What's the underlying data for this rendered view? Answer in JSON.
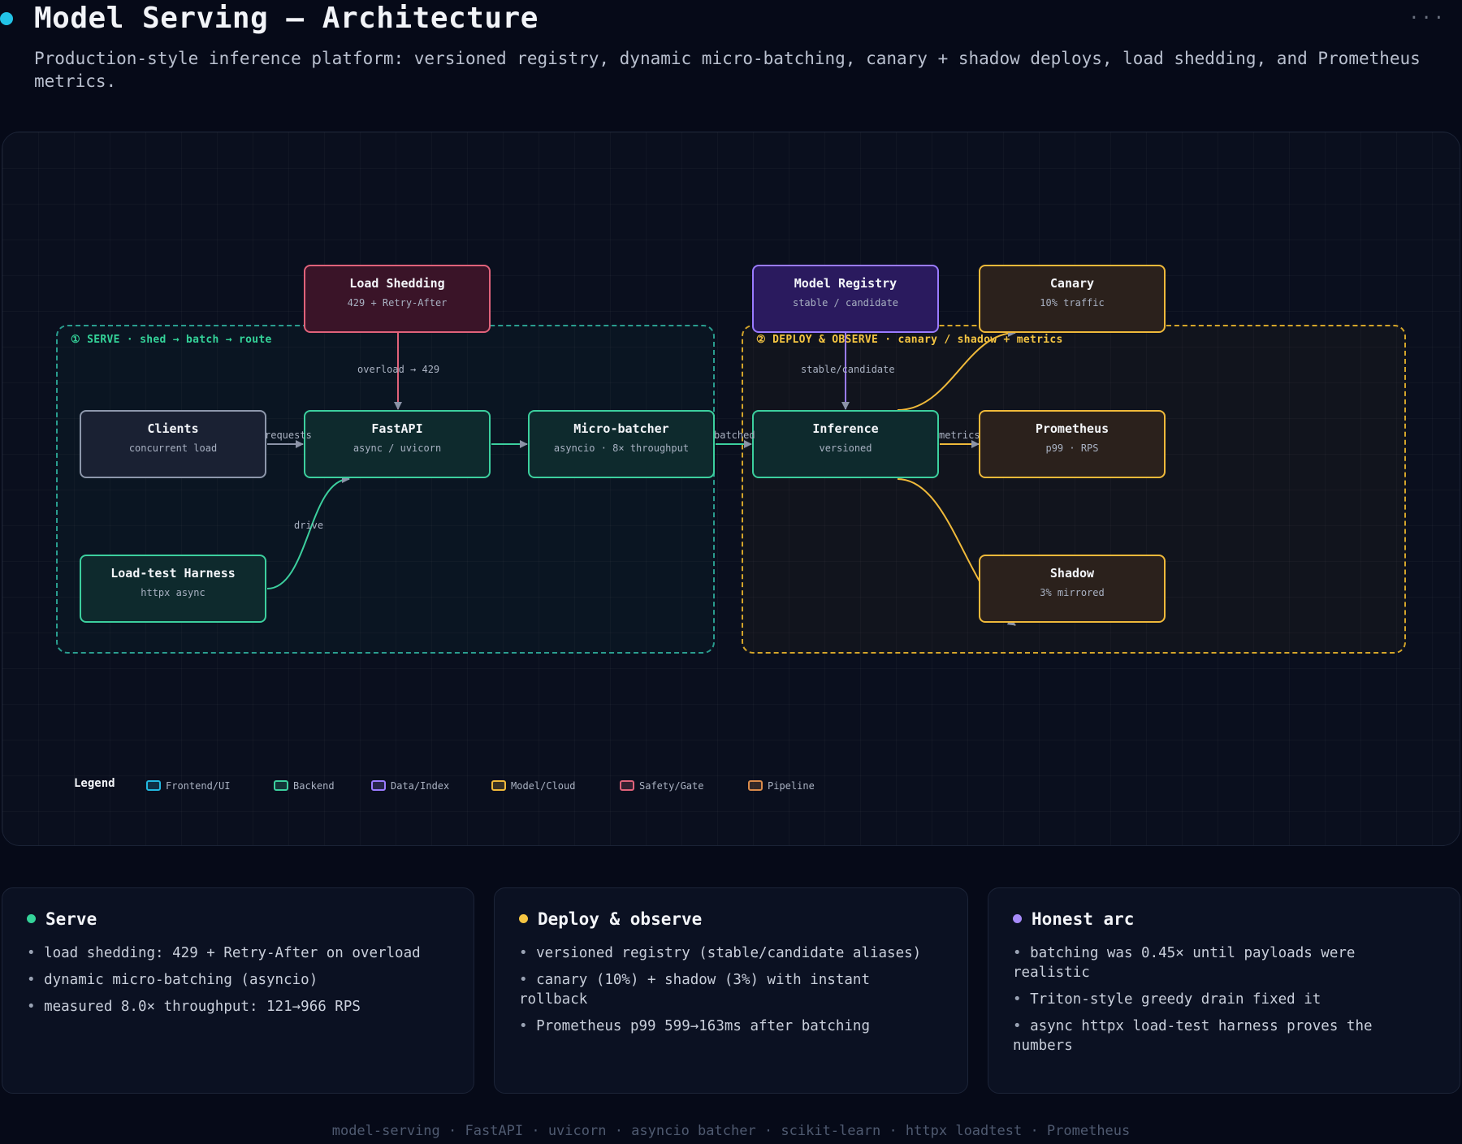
{
  "header": {
    "title": "Model Serving — Architecture",
    "subtitle": "Production-style inference platform: versioned registry, dynamic micro-batching, canary + shadow deploys, load shedding, and Prometheus metrics.",
    "more_icon": "more-icon",
    "dot_color": "#22c3e6"
  },
  "diagram": {
    "groups": {
      "serve": "① SERVE · shed → batch → route",
      "deploy": "② DEPLOY & OBSERVE · canary / shadow + metrics"
    },
    "nodes": {
      "load_shedding": {
        "title": "Load Shedding",
        "sub": "429 + Retry-After"
      },
      "model_registry": {
        "title": "Model Registry",
        "sub": "stable / candidate"
      },
      "canary": {
        "title": "Canary",
        "sub": "10% traffic"
      },
      "clients": {
        "title": "Clients",
        "sub": "concurrent load"
      },
      "fastapi": {
        "title": "FastAPI",
        "sub": "async / uvicorn"
      },
      "micro_batcher": {
        "title": "Micro-batcher",
        "sub": "asyncio · 8× throughput"
      },
      "inference": {
        "title": "Inference",
        "sub": "versioned"
      },
      "prometheus": {
        "title": "Prometheus",
        "sub": "p99 · RPS"
      },
      "load_test": {
        "title": "Load-test Harness",
        "sub": "httpx async"
      },
      "shadow": {
        "title": "Shadow",
        "sub": "3% mirrored"
      }
    },
    "edge_labels": {
      "overload": "overload → 429",
      "stable_candidate": "stable/candidate",
      "requests": "requests",
      "batched": "batched",
      "metrics": "metrics",
      "drive": "drive"
    }
  },
  "legend": {
    "title": "Legend",
    "items": [
      {
        "label": "Frontend/UI",
        "color": "#22b8e0"
      },
      {
        "label": "Backend",
        "color": "#3ccf9e"
      },
      {
        "label": "Data/Index",
        "color": "#9a7bff"
      },
      {
        "label": "Model/Cloud",
        "color": "#efb93a"
      },
      {
        "label": "Safety/Gate",
        "color": "#e0627a"
      },
      {
        "label": "Pipeline",
        "color": "#d98a4a"
      }
    ]
  },
  "cards": {
    "serve": {
      "title": "Serve",
      "color": "#34d399",
      "items": [
        "load shedding: 429 + Retry-After on overload",
        "dynamic micro-batching (asyncio)",
        "measured 8.0× throughput: 121→966 RPS"
      ]
    },
    "deploy": {
      "title": "Deploy & observe",
      "color": "#f5c542",
      "items": [
        "versioned registry (stable/candidate aliases)",
        "canary (10%) + shadow (3%) with instant rollback",
        "Prometheus p99 599→163ms after batching"
      ]
    },
    "honest": {
      "title": "Honest arc",
      "color": "#a78bfa",
      "items": [
        "batching was 0.45× until payloads were realistic",
        "Triton-style greedy drain fixed it",
        "async httpx load-test harness proves the numbers"
      ]
    }
  },
  "footer": "model-serving · FastAPI · uvicorn · asyncio batcher · scikit-learn · httpx loadtest · Prometheus"
}
